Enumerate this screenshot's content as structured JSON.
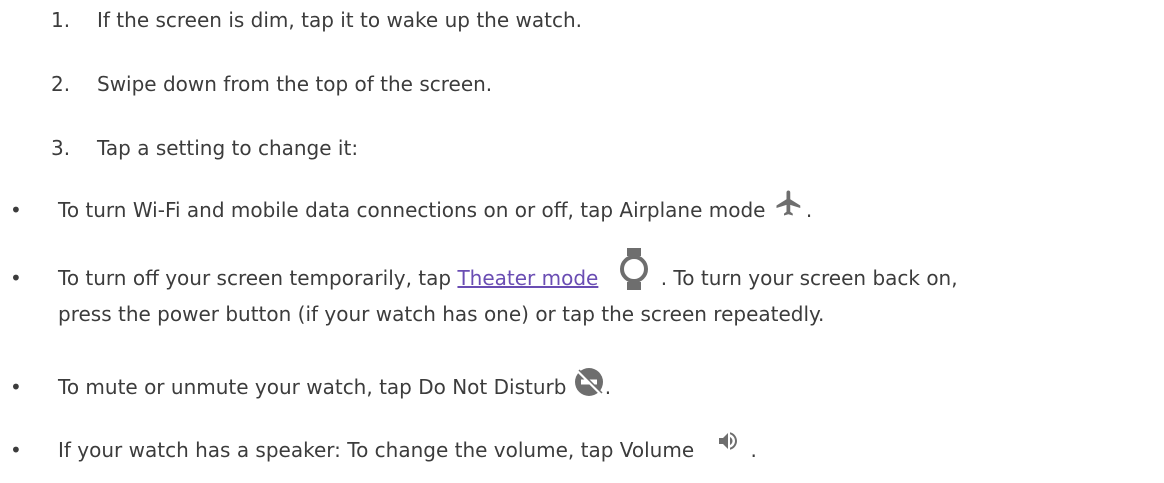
{
  "steps": [
    {
      "num": "1.",
      "text": "If the screen is dim, tap it to wake up the watch."
    },
    {
      "num": "2.",
      "text": "Swipe down from the top of the screen."
    },
    {
      "num": "3.",
      "text": "Tap a setting to change it:"
    }
  ],
  "bullets": {
    "b1": {
      "text": "To turn Wi-Fi and mobile data connections on or off, tap Airplane mode",
      "icon": "airplane-icon",
      "after": "."
    },
    "b2": {
      "before": "To turn off your screen temporarily, tap ",
      "link": "Theater mode",
      "icon": "watch-icon",
      "after": ". To turn your screen back on,",
      "line2": "press the power button (if your watch has one) or tap the screen repeatedly."
    },
    "b3": {
      "text": "To mute or unmute your watch, tap Do Not Disturb",
      "icon": "do-not-disturb-icon",
      "after": "."
    },
    "b4": {
      "text": "If your watch has a speaker: To change the volume, tap Volume",
      "icon": "volume-icon",
      "after": "."
    }
  },
  "bullet_char": "•",
  "colors": {
    "text": "#3c3c3c",
    "link": "#6a4db3",
    "icon": "#6e6e6e"
  }
}
